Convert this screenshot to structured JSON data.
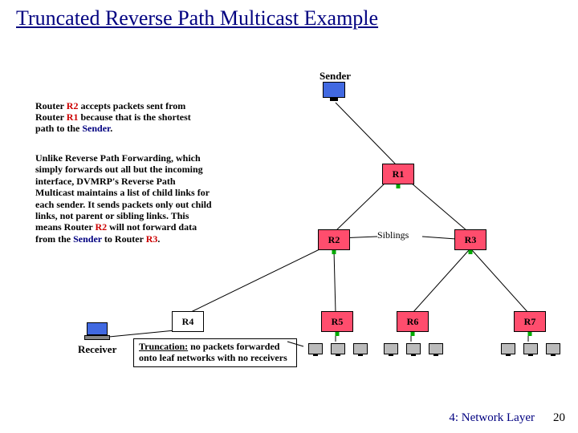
{
  "title": "Truncated Reverse Path Multicast Example",
  "sender_label": "Sender",
  "para1": {
    "pre": "Router ",
    "r2": "R2",
    "mid1": " accepts packets sent from Router ",
    "r1": "R1",
    "mid2": " because that is the shortest path to the ",
    "sender": "Sender",
    "end": "."
  },
  "para2": {
    "pre": "Unlike Reverse Path Forwarding, which simply forwards out all but the incoming interface, DVMRP's Reverse Path Multicast maintains a list of child links for each sender. It sends packets only out child links, not parent or sibling links. This means Router ",
    "r2": "R2",
    "mid": " will not forward data from the ",
    "sender": "Sender",
    "mid2": " to Router ",
    "r3": "R3",
    "end": "."
  },
  "routers": {
    "r1": "R1",
    "r2": "R2",
    "r3": "R3",
    "r4": "R4",
    "r5": "R5",
    "r6": "R6",
    "r7": "R7"
  },
  "siblings_label": "Siblings",
  "receiver_label": "Receiver",
  "callout": {
    "pre": "Truncation:",
    "rest": " no packets forwarded onto leaf networks with no receivers"
  },
  "footer": "4: Network Layer",
  "page_num": "20"
}
